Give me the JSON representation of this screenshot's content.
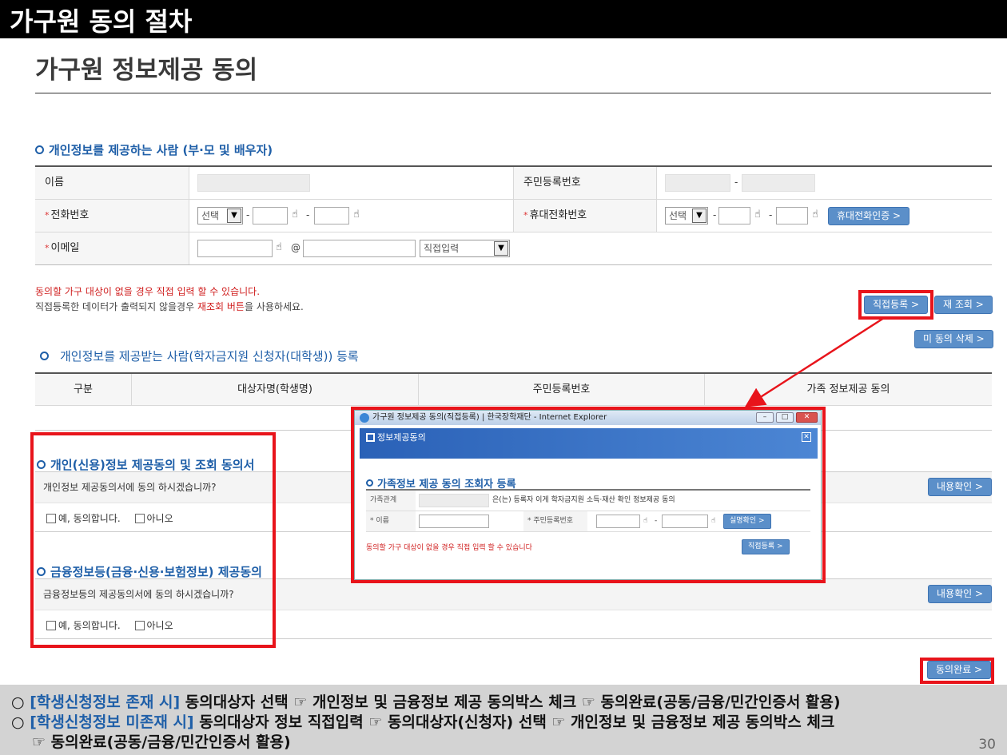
{
  "slide": {
    "header": "가구원 동의 절차",
    "page_title": "가구원 정보제공 동의",
    "page_number": "30"
  },
  "provider_section": {
    "heading": "개인정보를 제공하는 사람 (부·모 및 배우자)",
    "name_label": "이름",
    "rrn_label": "주민등록번호",
    "rrn_dash": "-",
    "phone_label": "전화번호",
    "phone_select": "선택",
    "mobile_label": "휴대전화번호",
    "mobile_select": "선택",
    "mobile_verify_button": "휴대전화인증 >",
    "email_label": "이메일",
    "email_at": "@",
    "email_domain_select": "직접입력",
    "required_mark": "*",
    "dash": "-"
  },
  "notes": {
    "line1": "동의할 가구 대상이 없을 경우 직접 입력 할 수 있습니다.",
    "line2_prefix": "직접등록한 데이터가 출력되지 않을경우 ",
    "line2_red": "재조회 버튼",
    "line2_suffix": "을 사용하세요."
  },
  "buttons": {
    "direct_register": "직접등록 >",
    "re_query": "재 조회 >",
    "delete_unconsented": "미 동의 삭제 >",
    "content_check_1": "내용확인 >",
    "content_check_2": "내용확인 >",
    "consent_complete": "동의완료 >"
  },
  "receiver_section": {
    "heading": "개인정보를 제공받는 사람(학자금지원 신청자(대학생)) 등록",
    "columns": [
      "구분",
      "대상자명(학생명)",
      "주민등록번호",
      "가족 정보제공 동의"
    ]
  },
  "consent_personal": {
    "heading": "개인(신용)정보 제공동의 및 조회 동의서",
    "question": "개인정보 제공동의서에 동의 하시겠습니까?",
    "yes": "예, 동의합니다.",
    "no": "아니오"
  },
  "consent_financial": {
    "heading": "금융정보등(금융·신용·보험정보) 제공동의",
    "question": "금융정보등의 제공동의서에 동의 하시겠습니까?",
    "yes": "예, 동의합니다.",
    "no": "아니오"
  },
  "popup": {
    "window_title": "가구원 정보제공 동의(직접등록) | 한국장학재단 - Internet Explorer",
    "header_title": "정보제공동의",
    "section_title": "가족정보 제공 동의 조회자 등록",
    "relation_label": "가족관계",
    "relation_text": "은(는) 등록자 이게 학자금지원 소득·재산 확인 정보제공 동의",
    "name_label": "* 이름",
    "rrn_label": "* 주민등록번호",
    "verify_button": "실명확인 >",
    "note": "동의할 가구 대상이 없을 경우 직접 입력 할 수 있습니다",
    "register_button": "직접등록 >"
  },
  "footer": {
    "line1_blue": "[학생신청정보 존재 시]",
    "line1_text": " 동의대상자 선택 ☞ 개인정보 및 금융정보 제공 동의박스 체크 ☞ 동의완료(공동/금융/민간인증서 활용)",
    "line2_blue": "[학생신청정보 미존재 시]",
    "line2_text": " 동의대상자 정보 직접입력 ☞ 동의대상자(신청자) 선택 ☞ 개인정보 및 금융정보 제공 동의박스 체크",
    "line3_text": "☞ 동의완료(공동/금융/민간인증서 활용)",
    "bullet": "○"
  }
}
